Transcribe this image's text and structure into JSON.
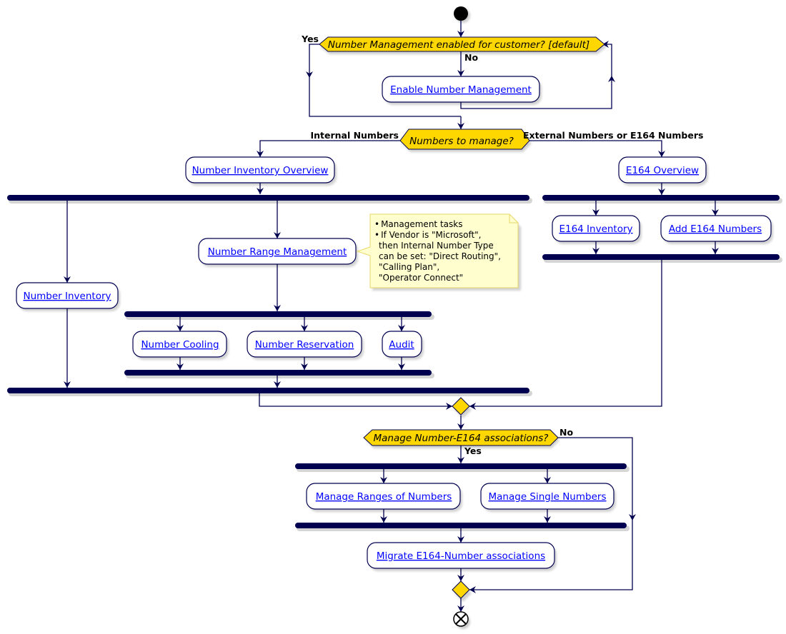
{
  "diagram": {
    "type": "activity",
    "start": "start-node",
    "end": "end-node",
    "colors": {
      "decision_fill": "#FFD700",
      "line": "#000050",
      "link": "#0000FF",
      "note_fill": "#FEFECE",
      "note_border": "#E8D76A"
    },
    "decisions": {
      "nm_enabled": "Number Management enabled for customer? [default]",
      "numbers_to_manage": "Numbers to manage?",
      "manage_assoc": "Manage Number-E164 associations?"
    },
    "labels": {
      "yes1": "Yes",
      "no1": "No",
      "internal": "Internal Numbers",
      "external": "External Numbers or E164 Numbers",
      "no2": "No",
      "yes2": "Yes"
    },
    "activities": {
      "enable_nm": "Enable Number Management",
      "inv_overview": "Number Inventory Overview",
      "e164_overview": "E164 Overview",
      "e164_inventory": "E164 Inventory",
      "add_e164": "Add E164 Numbers",
      "range_mgmt": "Number Range Management",
      "number_inventory": "Number Inventory",
      "cooling": "Number Cooling",
      "reservation": "Number Reservation",
      "audit": "Audit",
      "manage_ranges": "Manage Ranges of Numbers",
      "manage_single": "Manage Single Numbers",
      "migrate": "Migrate E164-Number associations"
    },
    "note": {
      "bullets": [
        "Management tasks",
        "If Vendor is \"Microsoft\","
      ],
      "continuation": [
        "then Internal Number Type",
        "can be set: \"Direct Routing\",",
        "\"Calling Plan\",",
        "\"Operator Connect\""
      ]
    }
  }
}
